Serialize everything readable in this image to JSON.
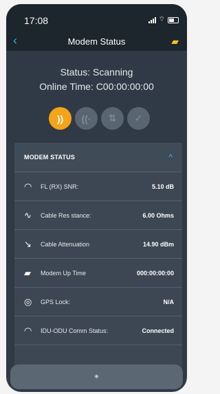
{
  "status_bar": {
    "time": "17:08"
  },
  "header": {
    "title": "Modem Status"
  },
  "status": {
    "status_text": "Status: Scanning",
    "online_time_text": "Online Time: C00:00:00:00"
  },
  "panel": {
    "title": "MODEM STATUS",
    "rows": [
      {
        "icon": "wifi-icon",
        "label": "FL (RX) SNR:",
        "value": "5.10 dB"
      },
      {
        "icon": "waveform-icon",
        "label": "Cable Res stance:",
        "value": "6.00 Ohms"
      },
      {
        "icon": "trend-down-icon",
        "label": "Cable Attenuation",
        "value": "14.90 dBm"
      },
      {
        "icon": "modem-icon",
        "label": "Modem Up Time",
        "value": "000:00:00:00"
      },
      {
        "icon": "gps-icon",
        "label": "GPS Lock:",
        "value": "N/A"
      },
      {
        "icon": "wifi-icon",
        "label": "IDU-ODU Comm Status:",
        "value": "Connected"
      }
    ]
  },
  "colors": {
    "accent": "#f5a318",
    "link": "#17b9e6",
    "header_bg": "#1d252d",
    "page_bg": "#2f3a46"
  }
}
